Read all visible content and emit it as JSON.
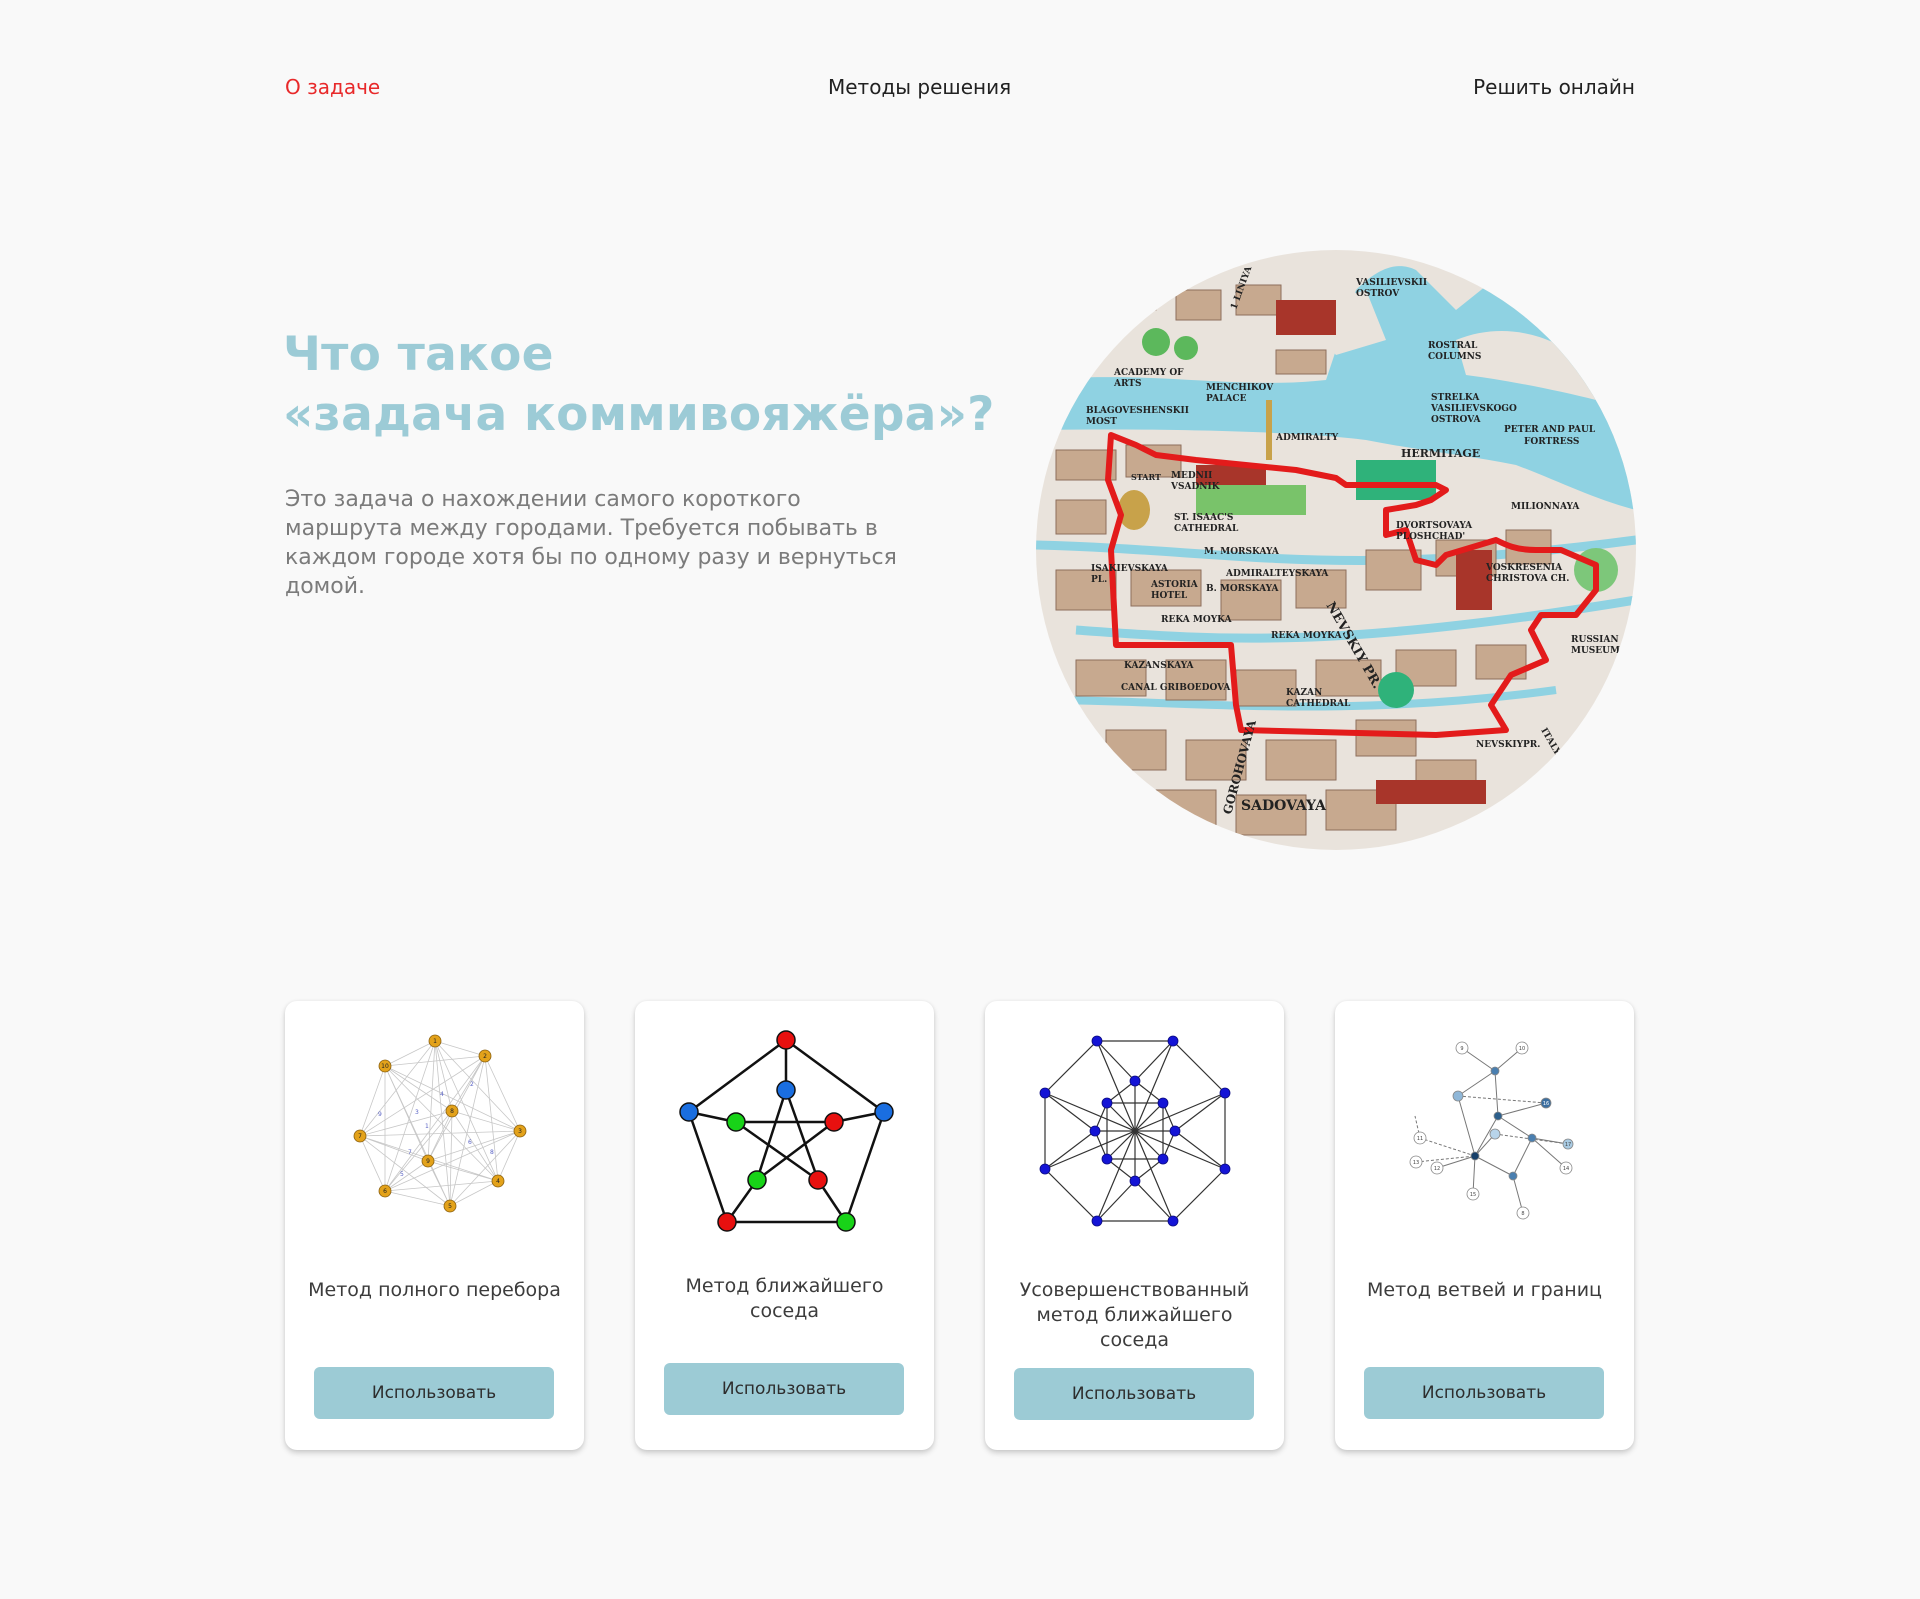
{
  "nav": {
    "about": "О задаче",
    "methods": "Методы решения",
    "solve_online": "Решить онлайн"
  },
  "hero": {
    "title_line1": "Что такое",
    "title_line2": "«задача коммивояжёра»?",
    "description": "Это задача о нахождении самого короткого маршрута между городами. Требуется побывать в каждом городе хотя бы по одному разу и вернуться домой."
  },
  "map": {
    "labels": [
      "VASILIEVSKII OSTROV",
      "ROSTRAL COLUMNS",
      "ACADEMY OF ARTS",
      "MENCHIKOV PALACE",
      "STRELKA VASILIEVSKOGO OSTROVA",
      "PETER AND PAUL FORTRESS",
      "BLAGOVESHENSKII MOST",
      "ADMIRALTY",
      "HERMITAGE",
      "MEDNII VSADNIK",
      "ST. ISAAC'S CATHEDRAL",
      "DVORTSOVAYA PLOSHCHAD'",
      "VOSKRESENIA CHRISTOVA CH.",
      "ISAKIEVSKAYA PL.",
      "ASTORIA HOTEL",
      "M. MORSKAYA",
      "ADMIRALTEYSKAYA",
      "B. MORSKAYA",
      "NEVSKIY PR.",
      "REKA MOYKA",
      "MILIONNAYA",
      "KAZANSKAYA",
      "CANAL GRIBOEDOVA",
      "KAZAN CATHEDRAL",
      "RUSSIAN MUSEUM",
      "ITALYA",
      "NEVSKIY PR.",
      "NEVS",
      "GOROHOVAYA",
      "SADOVAYA",
      "START",
      "1 LINIYA"
    ]
  },
  "methods": [
    {
      "title": "Метод полного перебора",
      "button": "Использовать",
      "icon": "complete-graph-icon"
    },
    {
      "title": "Метод ближайшего соседа",
      "button": "Использовать",
      "icon": "petersen-graph-icon"
    },
    {
      "title": "Усовершенствованный метод ближайшего соседа",
      "button": "Использовать",
      "icon": "star-graph-icon"
    },
    {
      "title": "Метод ветвей и границ",
      "button": "Использовать",
      "icon": "branch-tree-icon"
    }
  ],
  "graph_labels": {
    "complete": [
      "1",
      "2",
      "3",
      "4",
      "5",
      "6",
      "7",
      "8",
      "9",
      "10"
    ],
    "tree": [
      "9",
      "10",
      "8",
      "11",
      "12",
      "13",
      "14",
      "15",
      "16",
      "17"
    ]
  },
  "colors": {
    "accent_teal": "#9ccbd6",
    "nav_active_red": "#e8292a",
    "route_red": "#e31b1b",
    "water": "#8fd2e2",
    "node_gold": "#e3a21a",
    "node_blue": "#1a4cd6",
    "node_red": "#e8100f",
    "node_green": "#18d318"
  }
}
